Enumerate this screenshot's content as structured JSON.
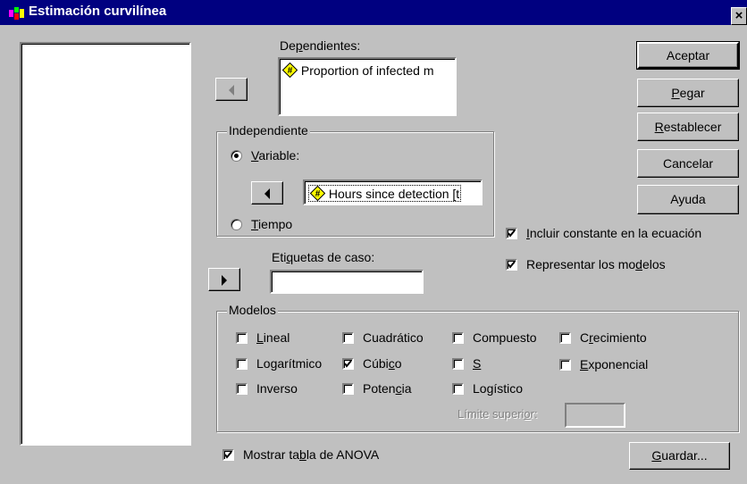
{
  "window": {
    "title": "Estimación curvilínea",
    "close_glyph": "×"
  },
  "variables_list": {
    "items": []
  },
  "dependents": {
    "label_pre": "De",
    "label_key": "p",
    "label_post": "endientes:",
    "items": [
      "Proportion of infected m"
    ]
  },
  "independent": {
    "group_label": "Independiente",
    "variable_key": "V",
    "variable_rest": "ariable:",
    "variable_value": "Hours since detection [t",
    "time_key": "T",
    "time_rest": "iempo",
    "selected": "variable"
  },
  "case_labels": {
    "label_pre": "Eti",
    "label_key": "q",
    "label_post": "uetas de caso:",
    "value": ""
  },
  "buttons": {
    "accept": "Aceptar",
    "paste_key": "P",
    "paste_rest": "egar",
    "reset_key": "R",
    "reset_rest": "establecer",
    "cancel": "Cancelar",
    "help": "Ayuda",
    "save_key": "G",
    "save_rest": "uardar..."
  },
  "options": {
    "include_constant": {
      "pre": "",
      "key": "I",
      "post": "ncluir constante en la ecuación",
      "checked": true
    },
    "plot_models": {
      "pre": "Representar los mo",
      "key": "d",
      "post": "elos",
      "checked": true
    }
  },
  "models": {
    "group_label": "Modelos",
    "linear": {
      "pre": "",
      "key": "L",
      "post": "ineal",
      "checked": false
    },
    "quadratic": {
      "pre": "Cuadrático",
      "key": "",
      "post": "",
      "checked": false
    },
    "compound": {
      "pre": "Compuesto",
      "key": "",
      "post": "",
      "checked": false
    },
    "growth": {
      "pre": "C",
      "key": "r",
      "post": "ecimiento",
      "checked": false
    },
    "logarithmic": {
      "pre": "Logarítmico",
      "key": "",
      "post": "",
      "checked": false
    },
    "cubic": {
      "pre": "Cúbi",
      "key": "c",
      "post": "o",
      "checked": true
    },
    "s": {
      "pre": "",
      "key": "S",
      "post": "",
      "checked": false
    },
    "exponential": {
      "pre": "",
      "key": "E",
      "post": "xponencial",
      "checked": false
    },
    "inverse": {
      "pre": "Inverso",
      "key": "",
      "post": "",
      "checked": false
    },
    "power": {
      "pre": "Poten",
      "key": "c",
      "post": "ia",
      "checked": false
    },
    "logistic": {
      "pre": "Logístico",
      "key": "",
      "post": "",
      "checked": false
    },
    "upper_limit": {
      "pre": "Límite superi",
      "key": "o",
      "post": "r:",
      "value": ""
    }
  },
  "anova": {
    "pre": "Mostrar ta",
    "key": "b",
    "post": "la de ANOVA",
    "checked": true
  }
}
